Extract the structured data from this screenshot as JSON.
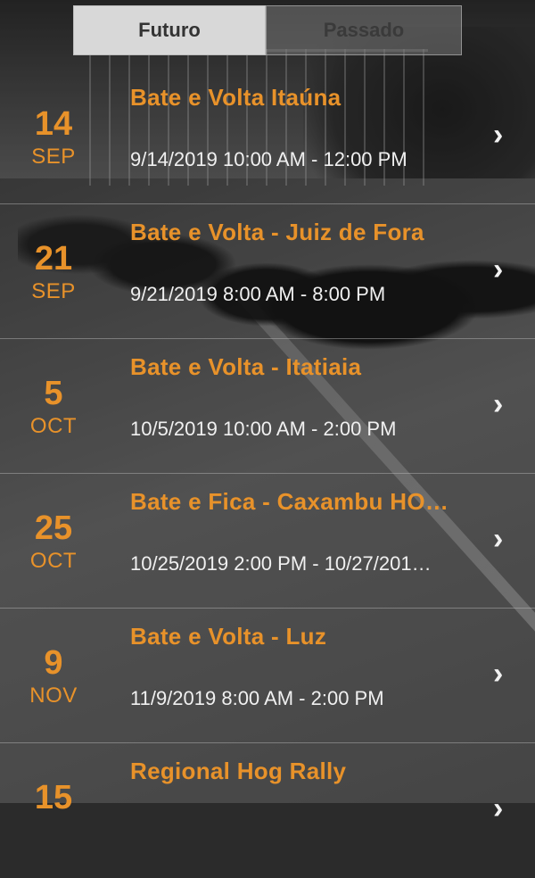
{
  "tabs": {
    "future_label": "Futuro",
    "past_label": "Passado"
  },
  "colors": {
    "accent": "#e8922a",
    "time_text": "#f0f0f0"
  },
  "events": [
    {
      "day": "14",
      "month": "SEP",
      "title": "Bate e Volta Itaúna",
      "time": "9/14/2019 10:00 AM - 12:00 PM"
    },
    {
      "day": "21",
      "month": "SEP",
      "title": "Bate e Volta - Juiz de Fora",
      "time": "9/21/2019 8:00 AM - 8:00 PM"
    },
    {
      "day": "5",
      "month": "OCT",
      "title": "Bate e Volta - Itatiaia",
      "time": "10/5/2019 10:00 AM - 2:00 PM"
    },
    {
      "day": "25",
      "month": "OCT",
      "title": "Bate e Fica - Caxambu HO…",
      "time": "10/25/2019 2:00 PM - 10/27/201…"
    },
    {
      "day": "9",
      "month": "NOV",
      "title": "Bate e Volta - Luz",
      "time": "11/9/2019 8:00 AM - 2:00 PM"
    },
    {
      "day": "15",
      "month": "",
      "title": "Regional Hog Rally",
      "time": ""
    }
  ]
}
